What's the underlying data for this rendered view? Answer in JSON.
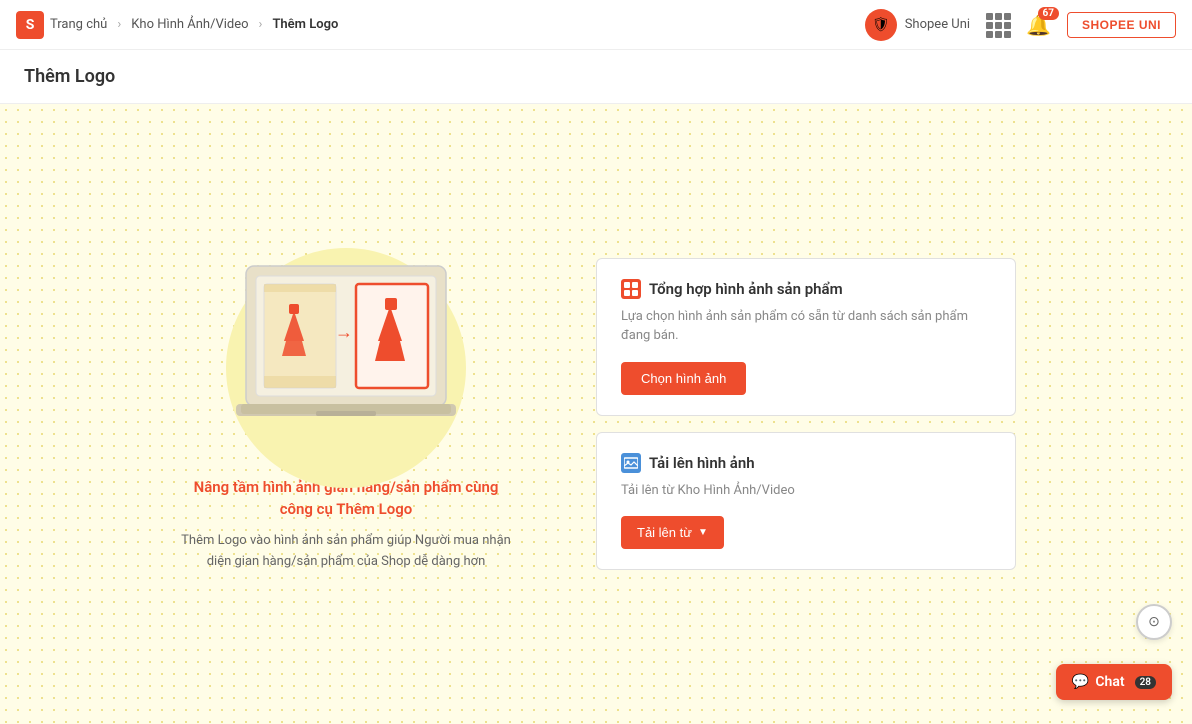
{
  "navbar": {
    "logo_text": "S",
    "breadcrumb": {
      "home": "Trang chủ",
      "parent": "Kho Hình Ảnh/Video",
      "current": "Thêm Logo"
    },
    "shopee_uni_label": "Shopee Uni",
    "notif_count": "67",
    "shopee_uni_btn": "SHOPEE UNI"
  },
  "page": {
    "title": "Thêm Logo"
  },
  "illustration": {
    "title": "Nâng tầm hình ảnh gian hàng/sản phẩm cùng công cụ Thêm Logo",
    "desc": "Thêm Logo vào hình ảnh sản phẩm giúp Người mua nhận diện gian hàng/sản phẩm của Shop dễ dàng hơn"
  },
  "cards": [
    {
      "id": "card-aggregate",
      "icon_type": "orange",
      "icon_char": "■",
      "title": "Tổng hợp hình ảnh sản phẩm",
      "desc": "Lựa chọn hình ảnh sản phẩm có sẵn từ danh sách sản phẩm đang bán.",
      "button_label": "Chọn hình ảnh"
    },
    {
      "id": "card-upload",
      "icon_type": "blue",
      "icon_char": "▦",
      "title": "Tải lên hình ảnh",
      "desc": "Tải lên từ Kho Hình Ảnh/Video",
      "button_label": "Tải lên từ"
    }
  ],
  "chat": {
    "label": "Chat",
    "badge": "28"
  },
  "help": {
    "icon": "?"
  }
}
